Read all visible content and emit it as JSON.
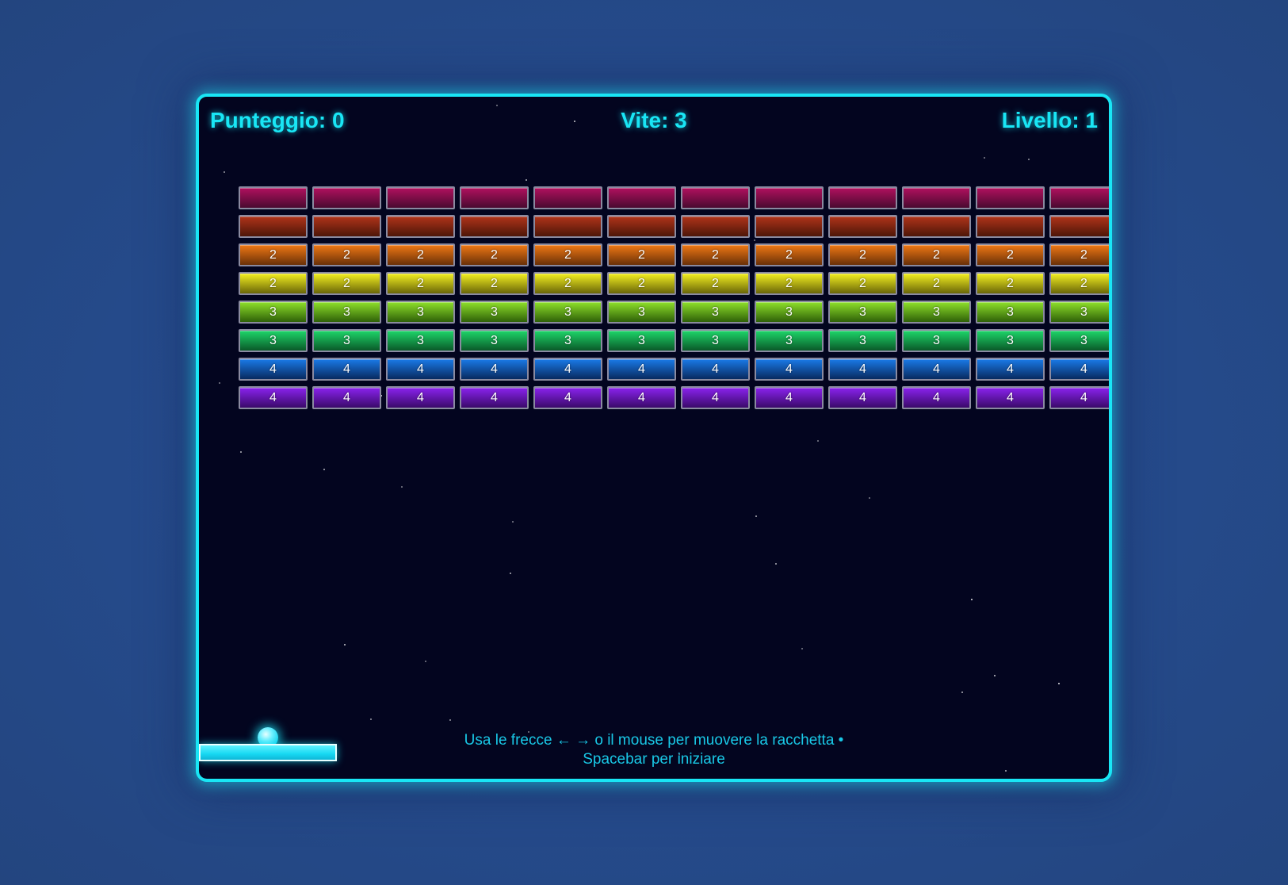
{
  "hud": {
    "score": "Punteggio: 0",
    "lives": "Vite: 3",
    "level": "Livello: 1"
  },
  "instructions": "Usa le frecce ← → o il mouse per muovere la racchetta • Spacebar per iniziare",
  "bricks": {
    "columns_visible": 12,
    "rows": [
      {
        "label": "",
        "color_top": "#b0105e",
        "color_bottom": "#4a0a30"
      },
      {
        "label": "",
        "color_top": "#b0341a",
        "color_bottom": "#4e1608"
      },
      {
        "label": "2",
        "color_top": "#f07814",
        "color_bottom": "#6a3008"
      },
      {
        "label": "2",
        "color_top": "#f4f020",
        "color_bottom": "#6a6608"
      },
      {
        "label": "3",
        "color_top": "#8ee02a",
        "color_bottom": "#2e6008"
      },
      {
        "label": "3",
        "color_top": "#1ed66a",
        "color_bottom": "#0a5a28"
      },
      {
        "label": "4",
        "color_top": "#1a7ae8",
        "color_bottom": "#082a60"
      },
      {
        "label": "4",
        "color_top": "#8a22ee",
        "color_bottom": "#3a0a6a"
      }
    ]
  },
  "colors": {
    "accent": "#19e6f5",
    "background": "#03051f",
    "page": "#254a8a"
  }
}
